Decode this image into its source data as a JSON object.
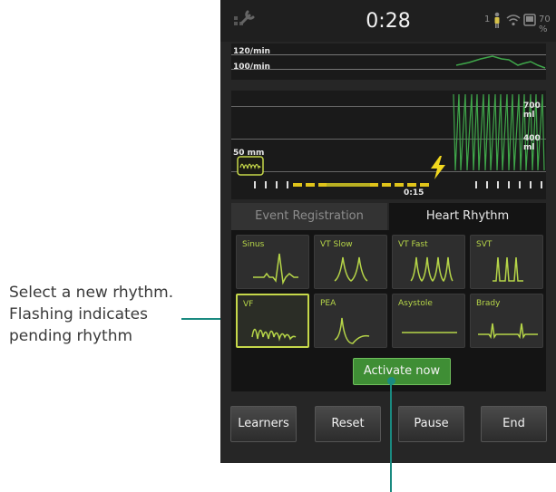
{
  "annotations": {
    "left_lines": [
      "Select a new rhythm.",
      "Flashing indicates",
      "pending rhythm"
    ]
  },
  "status": {
    "timer": "0:28",
    "battery_percent": "70 %",
    "signal_count": "1"
  },
  "trend": {
    "label_top": "120/min",
    "label_bottom": "100/min"
  },
  "monitor": {
    "label_700": "700 ml",
    "label_400": "400 ml",
    "label_50": "50 mm",
    "timeline_time": "0:15"
  },
  "tabs": [
    {
      "label": "Event Registration",
      "active": false
    },
    {
      "label": "Heart Rhythm",
      "active": true
    }
  ],
  "rhythms": [
    {
      "label": "Sinus",
      "icon": "sinus-waveform-icon"
    },
    {
      "label": "VT Slow",
      "icon": "vt-slow-waveform-icon"
    },
    {
      "label": "VT Fast",
      "icon": "vt-fast-waveform-icon"
    },
    {
      "label": "SVT",
      "icon": "svt-waveform-icon"
    },
    {
      "label": "VF",
      "icon": "vf-waveform-icon",
      "selected": true
    },
    {
      "label": "PEA",
      "icon": "pea-waveform-icon"
    },
    {
      "label": "Asystole",
      "icon": "asystole-waveform-icon"
    },
    {
      "label": "Brady",
      "icon": "brady-waveform-icon"
    }
  ],
  "activate_label": "Activate now",
  "bottom": {
    "learners": "Learners",
    "reset": "Reset",
    "pause": "Pause",
    "end": "End"
  },
  "colors": {
    "accent_green": "#b6d548",
    "waveform_green": "#3fa64a",
    "shock_yellow": "#f2d81e",
    "annotation_teal": "#1a8a80"
  }
}
